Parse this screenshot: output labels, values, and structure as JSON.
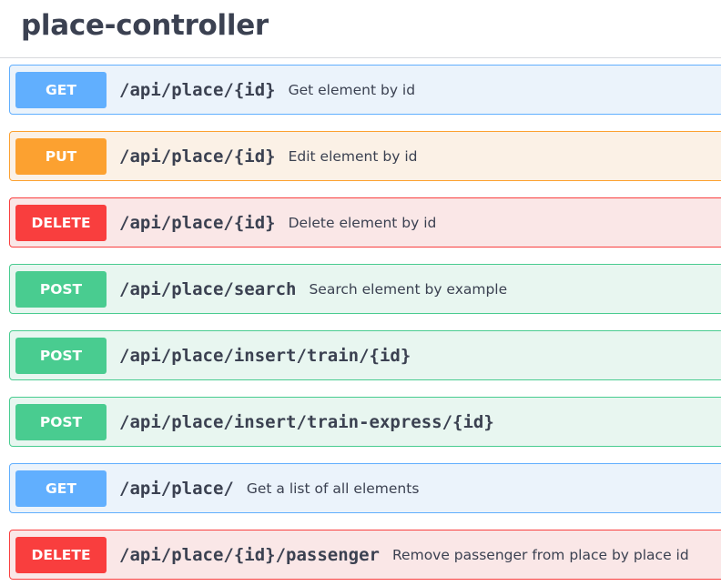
{
  "tag": {
    "title": "place-controller"
  },
  "operations": [
    {
      "method": "GET",
      "path": "/api/place/{id}",
      "summary": "Get element by id"
    },
    {
      "method": "PUT",
      "path": "/api/place/{id}",
      "summary": "Edit element by id"
    },
    {
      "method": "DELETE",
      "path": "/api/place/{id}",
      "summary": "Delete element by id"
    },
    {
      "method": "POST",
      "path": "/api/place/search",
      "summary": "Search element by example"
    },
    {
      "method": "POST",
      "path": "/api/place/insert/train/{id}",
      "summary": ""
    },
    {
      "method": "POST",
      "path": "/api/place/insert/train-express/{id}",
      "summary": ""
    },
    {
      "method": "GET",
      "path": "/api/place/",
      "summary": "Get a list of all elements"
    },
    {
      "method": "DELETE",
      "path": "/api/place/{id}/passenger",
      "summary": "Remove passenger from place by place id"
    }
  ],
  "colors": {
    "get": "#61affe",
    "put": "#fca130",
    "delete": "#f93e3e",
    "post": "#49cc90",
    "text": "#3b4151"
  }
}
